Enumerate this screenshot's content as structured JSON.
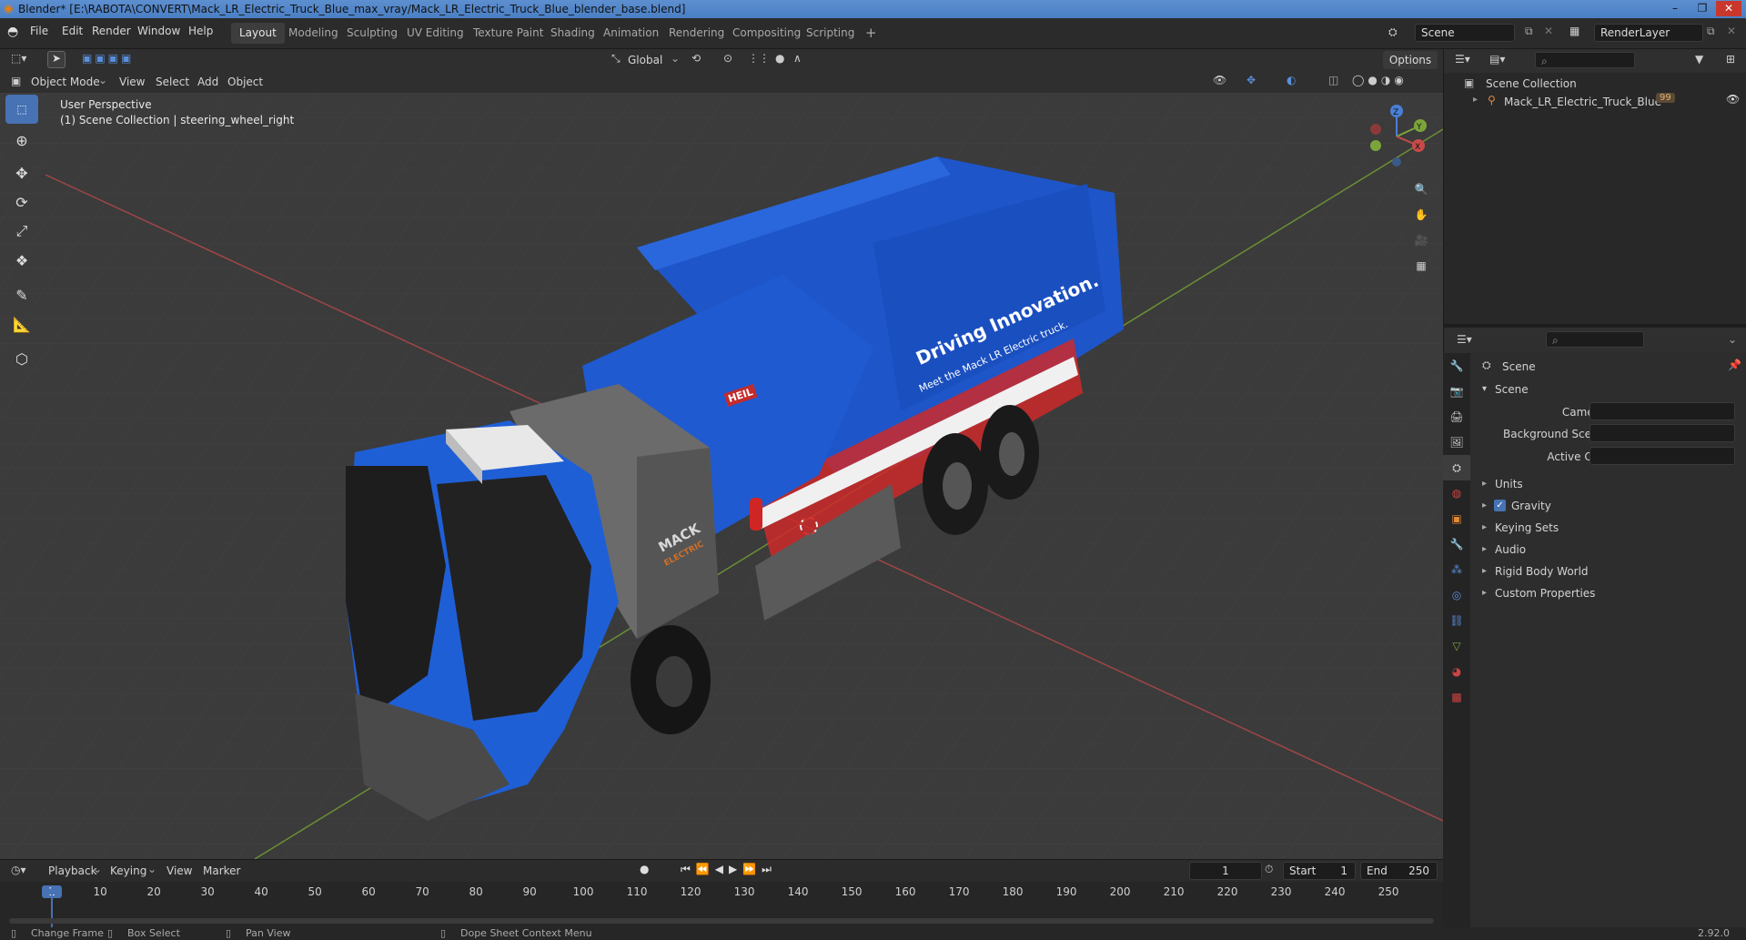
{
  "window": {
    "title": "Blender* [E:\\RABOTA\\CONVERT\\Mack_LR_Electric_Truck_Blue_max_vray/Mack_LR_Electric_Truck_Blue_blender_base.blend]",
    "minimize": "–",
    "maximize": "❐",
    "close": "✕"
  },
  "menu": [
    "File",
    "Edit",
    "Render",
    "Window",
    "Help"
  ],
  "workspaces": [
    "Layout",
    "Modeling",
    "Sculpting",
    "UV Editing",
    "Texture Paint",
    "Shading",
    "Animation",
    "Rendering",
    "Compositing",
    "Scripting"
  ],
  "active_workspace": "Layout",
  "add_workspace": "+",
  "scene_field": "Scene",
  "renderlayer_field": "RenderLayer",
  "viewport_header": {
    "orientation": "Global",
    "options": "Options",
    "mode": "Object Mode",
    "menus": [
      "View",
      "Select",
      "Add",
      "Object"
    ]
  },
  "viewport": {
    "perspective_label": "User Perspective",
    "collection_label": "(1) Scene Collection | steering_wheel_right",
    "gizmo": {
      "z": "Z",
      "y": "Y",
      "x": "X"
    }
  },
  "truck_decal": {
    "headline": "Driving Innovation.",
    "subline": "Meet the Mack LR Electric truck.",
    "brand_cab": "MACK",
    "brand_cab_sub": "ELECTRIC",
    "badge": "HEIL"
  },
  "outliner": {
    "root": "Scene Collection",
    "items": [
      {
        "label": "Mack_LR_Electric_Truck_Blue",
        "badge": "99"
      }
    ]
  },
  "properties": {
    "header": "Scene",
    "panel": "Scene",
    "fields": [
      {
        "label": "Camera",
        "value": ""
      },
      {
        "label": "Background Scene",
        "value": ""
      },
      {
        "label": "Active Clip",
        "value": ""
      }
    ],
    "subpanels": [
      {
        "label": "Units",
        "checkbox": false
      },
      {
        "label": "Gravity",
        "checkbox": true
      },
      {
        "label": "Keying Sets",
        "checkbox": false
      },
      {
        "label": "Audio",
        "checkbox": false
      },
      {
        "label": "Rigid Body World",
        "checkbox": false
      },
      {
        "label": "Custom Properties",
        "checkbox": false
      }
    ]
  },
  "timeline": {
    "menus": [
      "Playback",
      "Keying",
      "View",
      "Marker"
    ],
    "current_frame": "1",
    "start_label": "Start",
    "start": "1",
    "end_label": "End",
    "end": "250",
    "ticks": [
      "1",
      "10",
      "20",
      "30",
      "40",
      "50",
      "60",
      "70",
      "80",
      "90",
      "100",
      "110",
      "120",
      "130",
      "140",
      "150",
      "160",
      "170",
      "180",
      "190",
      "200",
      "210",
      "220",
      "230",
      "240",
      "250"
    ]
  },
  "statusbar": {
    "items": [
      "Change Frame",
      "Box Select",
      "Pan View",
      "Dope Sheet Context Menu"
    ],
    "version": "2.92.0"
  },
  "colors": {
    "accent": "#4772b3",
    "truck_blue": "#1f5fd6",
    "axis_x": "#c94a4a",
    "axis_y": "#7ba53a",
    "axis_z": "#4a7fd6"
  }
}
